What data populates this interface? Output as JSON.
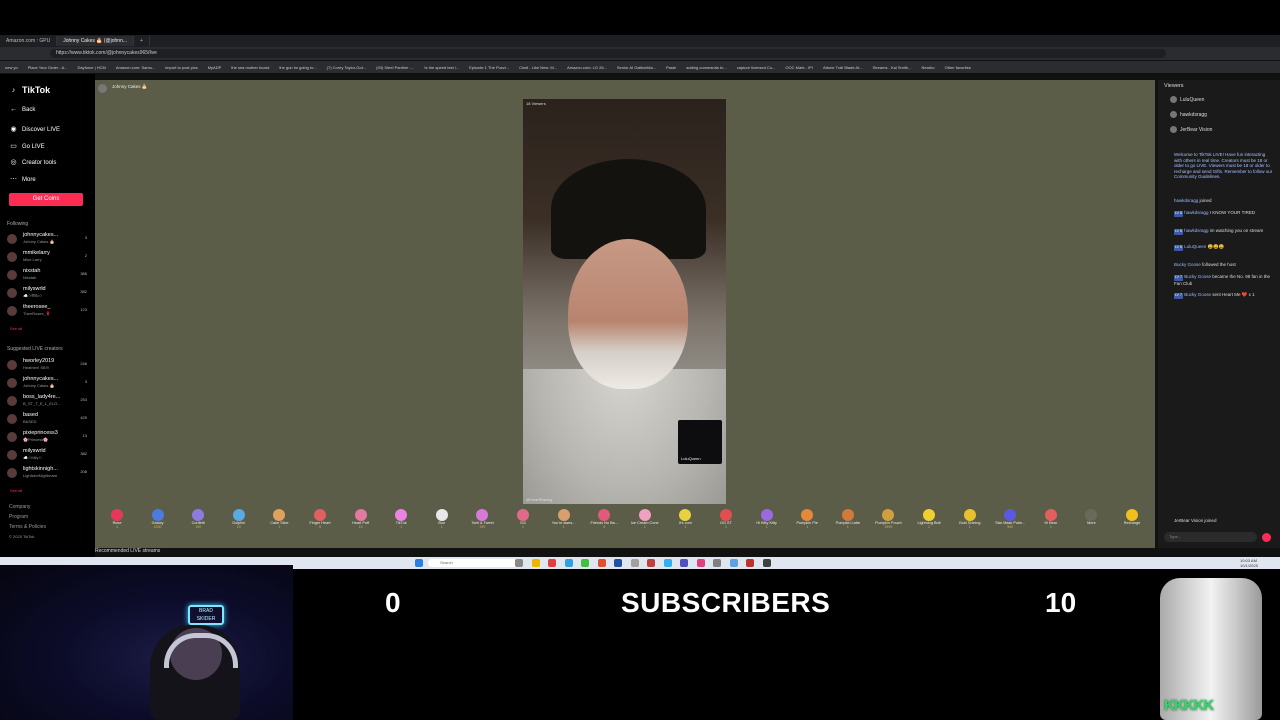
{
  "browser": {
    "tabs": [
      "Amazon.com : GPU",
      "Johnny Cakes 🎂 (@johnn...",
      "+"
    ],
    "url": "https://www.tiktok.com/@johnnycakes965/live",
    "bookmarks": [
      "new yo",
      "Place Your Order - A...",
      "Dayforce | HCM",
      "Amazon.com: Samu...",
      "import to post pics",
      "MyADP",
      "the sea mother board",
      "the gun im going to...",
      "(7) Corey Taylor-Got...",
      "(93) Steel Panther -...",
      "Is the speed test i...",
      "Episode 1 The Puzzl...",
      "Cindi - Like New: M...",
      "Amazon.com: LG 26...",
      "Senior AI GatitunMa...",
      "Paste",
      "adding commands to...",
      "capture licensed Co...",
      "OOC Mark - IPI",
      "Attune Trail Blade At...",
      "Streams - Kai Smith...",
      "Nearbo",
      "Other favorites"
    ]
  },
  "sidebar": {
    "logo": "TikTok",
    "back": "Back",
    "nav": [
      "Discover LIVE",
      "Go LIVE",
      "Creator tools",
      "More"
    ],
    "get_coins": "Get Coins",
    "following_title": "Following",
    "following": [
      {
        "name": "johnnycakes...",
        "sub": "Johnny Cakes 🎂",
        "count": "3"
      },
      {
        "name": "mmikelarry",
        "sub": "Mike Larry",
        "count": "2"
      },
      {
        "name": "nixstah",
        "sub": "Nixstah",
        "count": "386"
      },
      {
        "name": "milyswrld",
        "sub": "☁️✩𝔐𝔦𝔩𝔶✩",
        "count": "382"
      },
      {
        "name": "theerosee_",
        "sub": "TheeRosee_🌹",
        "count": "123"
      }
    ],
    "see_all_1": "See all",
    "suggested_title": "Suggested LIVE creators",
    "suggested": [
      {
        "name": "hworley2019",
        "sub": "Heathen! SB!!!",
        "count": "246"
      },
      {
        "name": "johnnycakes...",
        "sub": "Johnny Cakes 🎂",
        "count": "3"
      },
      {
        "name": "boss_lady4re...",
        "sub": "B_ST_T_E_L_ELO...",
        "count": "253"
      },
      {
        "name": "based",
        "sub": "BASED",
        "count": "425"
      },
      {
        "name": "pixieprincess3",
        "sub": "🌸Princess🌸",
        "count": "13"
      },
      {
        "name": "milyswrld",
        "sub": "☁️✩Mily✩",
        "count": "382"
      },
      {
        "name": "lightskinnigh...",
        "sub": "LightskinNightmare",
        "count": "208"
      }
    ],
    "see_all_2": "See all",
    "footer": [
      "Company",
      "Program",
      "Terms & Policies",
      "© 2025 TikTok"
    ]
  },
  "stage": {
    "host_name": "Johnny Cakes 🎂",
    "video_tag": "18 Viewers",
    "video_bottom": "@HeartRacing",
    "pip_name": "LuluQueen",
    "recommended": "Recommended LIVE streams"
  },
  "gifts": [
    {
      "name": "Rose",
      "price": "1",
      "color": "#e8385a"
    },
    {
      "name": "Galaxy",
      "price": "1000",
      "color": "#4b7be0"
    },
    {
      "name": "Confetti",
      "price": "100",
      "color": "#8f7be0"
    },
    {
      "name": "Dolphin",
      "price": "10",
      "color": "#5aa9e0"
    },
    {
      "name": "Cake Slice",
      "price": "1",
      "color": "#e0a060"
    },
    {
      "name": "Finger Heart",
      "price": "5",
      "color": "#e06060"
    },
    {
      "name": "Heart Puff",
      "price": "10",
      "color": "#e07aa0"
    },
    {
      "name": "TikTok",
      "price": "1",
      "color": "#ea84e0"
    },
    {
      "name": "Boo",
      "price": "1",
      "color": "#e8e8e8"
    },
    {
      "name": "Twirl & Tweet",
      "price": "299",
      "color": "#d77ad7"
    },
    {
      "name": "GG",
      "price": "1",
      "color": "#e06a8a"
    },
    {
      "name": "You're awes...",
      "price": "1",
      "color": "#d8a070"
    },
    {
      "name": "Friends No Ba...",
      "price": "5",
      "color": "#e05a7a"
    },
    {
      "name": "Ice Cream Cone",
      "price": "1",
      "color": "#f0a0c0"
    },
    {
      "name": "It's corn",
      "price": "1",
      "color": "#e8d040"
    },
    {
      "name": "GG ST",
      "price": "1",
      "color": "#e05050"
    },
    {
      "name": "Hi Kitty Kitty",
      "price": "1",
      "color": "#9a6ae0"
    },
    {
      "name": "Pumpkin Pie",
      "price": "1",
      "color": "#e08a3a"
    },
    {
      "name": "Pumpkin Latte",
      "price": "1",
      "color": "#d07a3a"
    },
    {
      "name": "Pumpkin Pouch",
      "price": "2999",
      "color": "#d0a040"
    },
    {
      "name": "Lightning Bolt",
      "price": "1",
      "color": "#f0d030"
    },
    {
      "name": "Gold Shining",
      "price": "1",
      "color": "#e8c030"
    },
    {
      "name": "Star Mask Poke...",
      "price": "500",
      "color": "#5a5ae0"
    },
    {
      "name": "Hi Bear",
      "price": "1",
      "color": "#e06060"
    },
    {
      "name": "More",
      "price": "",
      "color": "#6a6a5a"
    },
    {
      "name": "Recharge",
      "price": "",
      "color": "#f0c020"
    }
  ],
  "chat": {
    "viewers_title": "Viewers",
    "viewers": [
      "LuluQueen",
      "hawkdsragg",
      "JerBear Vision"
    ],
    "welcome": "Welcome to TikTok LIVE! Have fun interacting with others in real time. Creators must be 18 or older to go LIVE. Viewers must be 18 or older to recharge and send Gifts. Remember to follow our Community Guidelines.",
    "messages": [
      {
        "user": "hawkdsragg",
        "text": "joined",
        "badge": ""
      },
      {
        "user": "hawkdsragg",
        "text": "I KNOW YOUR TIRED",
        "badge": "LV 8"
      },
      {
        "user": "hawkdsragg",
        "text": "im watching you on stream",
        "badge": "LV 8"
      },
      {
        "user": "LuluQueen",
        "text": "😀😀😀",
        "badge": "LV 8"
      },
      {
        "user": "Bucky Goose",
        "text": "followed the host",
        "badge": ""
      },
      {
        "user": "Bucky Goose",
        "text": "became the No. 98 fan in the Fan Club",
        "badge": "LV 7"
      },
      {
        "user": "Bucky Goose",
        "text": "sent Heart Me ❤️ x 1",
        "badge": "LV 7"
      }
    ],
    "joined_line": "JerBear Vision  joined",
    "input_placeholder": "Type..."
  },
  "taskbar": {
    "search": "Search",
    "time": "10:03 AM",
    "date": "10/1/2025"
  },
  "overlay": {
    "neon_sign": "BRAD SKIDER",
    "counter_left": "0",
    "counter_title": "SUBSCRIBERS",
    "counter_right": "10",
    "jar_text": "KKKKK"
  }
}
